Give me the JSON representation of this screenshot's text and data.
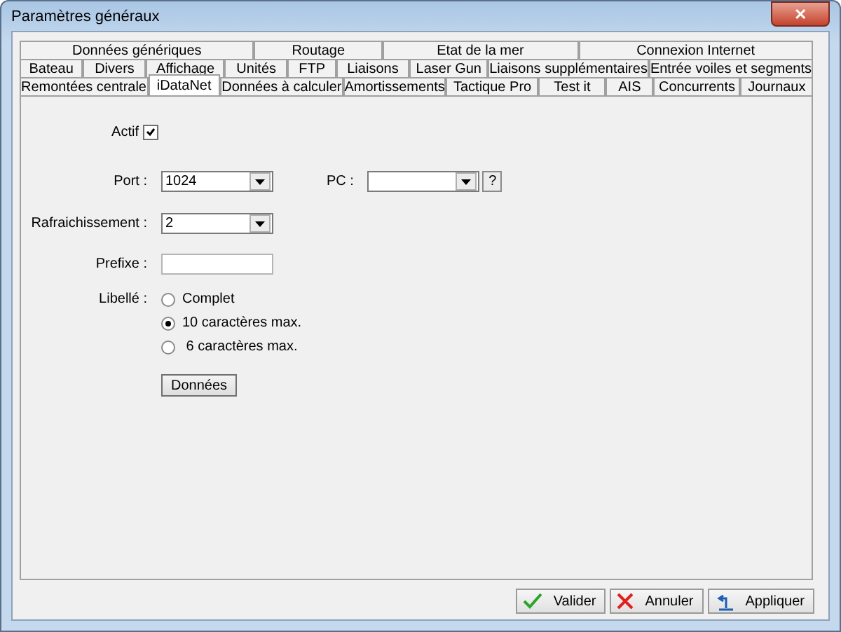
{
  "window": {
    "title": "Paramètres généraux",
    "close": "✕"
  },
  "tab_rows": [
    [
      {
        "label": "Données génériques",
        "selected": false
      },
      {
        "label": "Routage",
        "selected": false
      },
      {
        "label": "Etat de la mer",
        "selected": false
      },
      {
        "label": "Connexion Internet",
        "selected": false
      }
    ],
    [
      {
        "label": "Bateau",
        "selected": false
      },
      {
        "label": "Divers",
        "selected": false
      },
      {
        "label": "Affichage",
        "selected": false
      },
      {
        "label": "Unités",
        "selected": false
      },
      {
        "label": "FTP",
        "selected": false
      },
      {
        "label": "Liaisons",
        "selected": false
      },
      {
        "label": "Laser Gun",
        "selected": false
      },
      {
        "label": "Liaisons supplémentaires",
        "selected": false
      },
      {
        "label": "Entrée voiles et segments",
        "selected": false
      }
    ],
    [
      {
        "label": "Remontées centrale",
        "selected": false
      },
      {
        "label": "iDataNet",
        "selected": true
      },
      {
        "label": "Données à calculer",
        "selected": false
      },
      {
        "label": "Amortissements",
        "selected": false
      },
      {
        "label": "Tactique Pro",
        "selected": false
      },
      {
        "label": "Test it",
        "selected": false
      },
      {
        "label": "AIS",
        "selected": false
      },
      {
        "label": "Concurrents",
        "selected": false
      },
      {
        "label": "Journaux",
        "selected": false
      }
    ]
  ],
  "form": {
    "actif": {
      "label": "Actif",
      "checked": true
    },
    "port": {
      "label": "Port :",
      "value": "1024"
    },
    "pc": {
      "label": "PC :",
      "help": "?"
    },
    "refresh": {
      "label": "Rafraichissement :",
      "value": "2"
    },
    "prefix": {
      "label": "Prefixe :"
    },
    "libelle": {
      "label": "Libellé :",
      "options": [
        {
          "label": "Complet",
          "selected": false
        },
        {
          "label": "10 caractères max.",
          "selected": true
        },
        {
          "label": " 6 caractères max.",
          "selected": false
        }
      ]
    },
    "data_button": "Données"
  },
  "buttons": [
    {
      "kind": "ok",
      "label": "Valider"
    },
    {
      "kind": "cancel",
      "label": "Annuler"
    },
    {
      "kind": "apply",
      "label": "Appliquer"
    }
  ]
}
